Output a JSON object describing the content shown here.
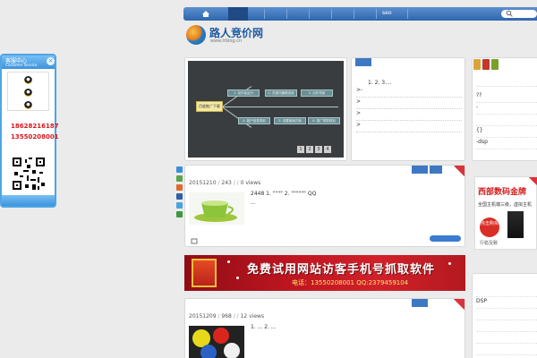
{
  "nav": {
    "seo_label": "seo"
  },
  "logo": {
    "name": "路人竞价网",
    "domain": "www.lrblog.cn"
  },
  "slider": {
    "center_label": "百度推广下载",
    "nodes": [
      "1. 创作者运行",
      "2. 关键词编辑选择",
      "3. 创作场景",
      "4. 账户信息规划",
      "5. 设置营销方案",
      "6. 推广预算规划"
    ],
    "pages": [
      "1",
      "2",
      "3",
      "4"
    ]
  },
  "midbox": {
    "head": "1. 2. 3....",
    "rows": [
      ">-",
      ">",
      ">",
      ">"
    ]
  },
  "rightbox": {
    "rows_top": [
      "??",
      "-"
    ],
    "rows_bottom": [
      "{}",
      "-dsp"
    ],
    "rows_dsp": [
      "DSP"
    ]
  },
  "post1": {
    "date": "20151210",
    "count": "243",
    "views": "0 views",
    "line1": "2448 1. \"\"\"\" 2. \"\"\"\"\"\"  QQ",
    "line2": "..."
  },
  "post2": {
    "date": "20151209",
    "count": "968",
    "views": "12 views",
    "line1": "1. ... 2. ..."
  },
  "banner": {
    "title": "免费试用网站访客手机号抓取软件",
    "phone": "电话：13550208001  QQ:2379459104"
  },
  "service": {
    "title": "客服中心",
    "subtitle": "Customer Service",
    "close": "×",
    "phones": [
      "18628216187",
      "13550208001"
    ]
  },
  "ad_right": {
    "title": "西部数码金牌",
    "subtitle": "全国主机端三级，虚拟主机",
    "button": "点击购买",
    "footer": "行稳及致"
  },
  "colors": {
    "nav_blue": "#2f66ad",
    "accent_red": "#d8171c"
  }
}
